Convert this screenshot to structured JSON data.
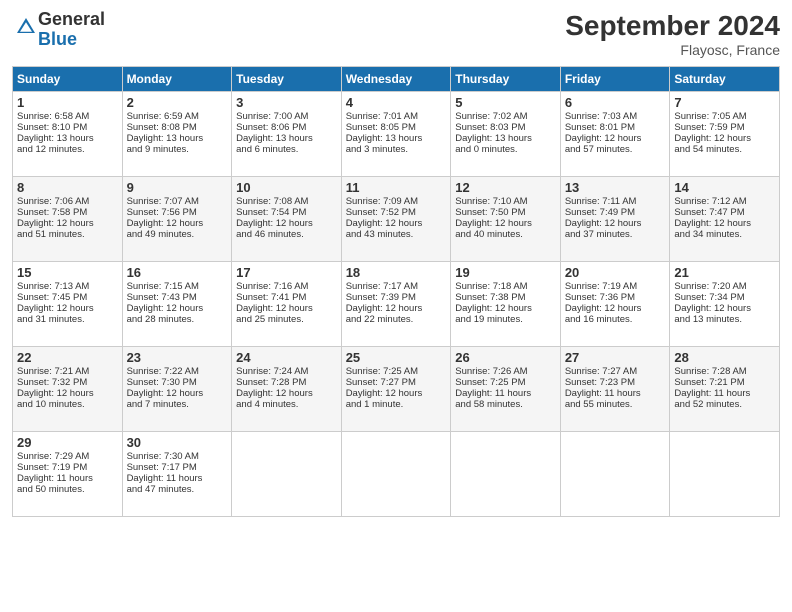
{
  "header": {
    "logo_general": "General",
    "logo_blue": "Blue",
    "month_title": "September 2024",
    "location": "Flayosc, France"
  },
  "days_of_week": [
    "Sunday",
    "Monday",
    "Tuesday",
    "Wednesday",
    "Thursday",
    "Friday",
    "Saturday"
  ],
  "weeks": [
    [
      {
        "day": "1",
        "lines": [
          "Sunrise: 6:58 AM",
          "Sunset: 8:10 PM",
          "Daylight: 13 hours",
          "and 12 minutes."
        ]
      },
      {
        "day": "2",
        "lines": [
          "Sunrise: 6:59 AM",
          "Sunset: 8:08 PM",
          "Daylight: 13 hours",
          "and 9 minutes."
        ]
      },
      {
        "day": "3",
        "lines": [
          "Sunrise: 7:00 AM",
          "Sunset: 8:06 PM",
          "Daylight: 13 hours",
          "and 6 minutes."
        ]
      },
      {
        "day": "4",
        "lines": [
          "Sunrise: 7:01 AM",
          "Sunset: 8:05 PM",
          "Daylight: 13 hours",
          "and 3 minutes."
        ]
      },
      {
        "day": "5",
        "lines": [
          "Sunrise: 7:02 AM",
          "Sunset: 8:03 PM",
          "Daylight: 13 hours",
          "and 0 minutes."
        ]
      },
      {
        "day": "6",
        "lines": [
          "Sunrise: 7:03 AM",
          "Sunset: 8:01 PM",
          "Daylight: 12 hours",
          "and 57 minutes."
        ]
      },
      {
        "day": "7",
        "lines": [
          "Sunrise: 7:05 AM",
          "Sunset: 7:59 PM",
          "Daylight: 12 hours",
          "and 54 minutes."
        ]
      }
    ],
    [
      {
        "day": "8",
        "lines": [
          "Sunrise: 7:06 AM",
          "Sunset: 7:58 PM",
          "Daylight: 12 hours",
          "and 51 minutes."
        ]
      },
      {
        "day": "9",
        "lines": [
          "Sunrise: 7:07 AM",
          "Sunset: 7:56 PM",
          "Daylight: 12 hours",
          "and 49 minutes."
        ]
      },
      {
        "day": "10",
        "lines": [
          "Sunrise: 7:08 AM",
          "Sunset: 7:54 PM",
          "Daylight: 12 hours",
          "and 46 minutes."
        ]
      },
      {
        "day": "11",
        "lines": [
          "Sunrise: 7:09 AM",
          "Sunset: 7:52 PM",
          "Daylight: 12 hours",
          "and 43 minutes."
        ]
      },
      {
        "day": "12",
        "lines": [
          "Sunrise: 7:10 AM",
          "Sunset: 7:50 PM",
          "Daylight: 12 hours",
          "and 40 minutes."
        ]
      },
      {
        "day": "13",
        "lines": [
          "Sunrise: 7:11 AM",
          "Sunset: 7:49 PM",
          "Daylight: 12 hours",
          "and 37 minutes."
        ]
      },
      {
        "day": "14",
        "lines": [
          "Sunrise: 7:12 AM",
          "Sunset: 7:47 PM",
          "Daylight: 12 hours",
          "and 34 minutes."
        ]
      }
    ],
    [
      {
        "day": "15",
        "lines": [
          "Sunrise: 7:13 AM",
          "Sunset: 7:45 PM",
          "Daylight: 12 hours",
          "and 31 minutes."
        ]
      },
      {
        "day": "16",
        "lines": [
          "Sunrise: 7:15 AM",
          "Sunset: 7:43 PM",
          "Daylight: 12 hours",
          "and 28 minutes."
        ]
      },
      {
        "day": "17",
        "lines": [
          "Sunrise: 7:16 AM",
          "Sunset: 7:41 PM",
          "Daylight: 12 hours",
          "and 25 minutes."
        ]
      },
      {
        "day": "18",
        "lines": [
          "Sunrise: 7:17 AM",
          "Sunset: 7:39 PM",
          "Daylight: 12 hours",
          "and 22 minutes."
        ]
      },
      {
        "day": "19",
        "lines": [
          "Sunrise: 7:18 AM",
          "Sunset: 7:38 PM",
          "Daylight: 12 hours",
          "and 19 minutes."
        ]
      },
      {
        "day": "20",
        "lines": [
          "Sunrise: 7:19 AM",
          "Sunset: 7:36 PM",
          "Daylight: 12 hours",
          "and 16 minutes."
        ]
      },
      {
        "day": "21",
        "lines": [
          "Sunrise: 7:20 AM",
          "Sunset: 7:34 PM",
          "Daylight: 12 hours",
          "and 13 minutes."
        ]
      }
    ],
    [
      {
        "day": "22",
        "lines": [
          "Sunrise: 7:21 AM",
          "Sunset: 7:32 PM",
          "Daylight: 12 hours",
          "and 10 minutes."
        ]
      },
      {
        "day": "23",
        "lines": [
          "Sunrise: 7:22 AM",
          "Sunset: 7:30 PM",
          "Daylight: 12 hours",
          "and 7 minutes."
        ]
      },
      {
        "day": "24",
        "lines": [
          "Sunrise: 7:24 AM",
          "Sunset: 7:28 PM",
          "Daylight: 12 hours",
          "and 4 minutes."
        ]
      },
      {
        "day": "25",
        "lines": [
          "Sunrise: 7:25 AM",
          "Sunset: 7:27 PM",
          "Daylight: 12 hours",
          "and 1 minute."
        ]
      },
      {
        "day": "26",
        "lines": [
          "Sunrise: 7:26 AM",
          "Sunset: 7:25 PM",
          "Daylight: 11 hours",
          "and 58 minutes."
        ]
      },
      {
        "day": "27",
        "lines": [
          "Sunrise: 7:27 AM",
          "Sunset: 7:23 PM",
          "Daylight: 11 hours",
          "and 55 minutes."
        ]
      },
      {
        "day": "28",
        "lines": [
          "Sunrise: 7:28 AM",
          "Sunset: 7:21 PM",
          "Daylight: 11 hours",
          "and 52 minutes."
        ]
      }
    ],
    [
      {
        "day": "29",
        "lines": [
          "Sunrise: 7:29 AM",
          "Sunset: 7:19 PM",
          "Daylight: 11 hours",
          "and 50 minutes."
        ]
      },
      {
        "day": "30",
        "lines": [
          "Sunrise: 7:30 AM",
          "Sunset: 7:17 PM",
          "Daylight: 11 hours",
          "and 47 minutes."
        ]
      },
      {
        "day": "",
        "lines": []
      },
      {
        "day": "",
        "lines": []
      },
      {
        "day": "",
        "lines": []
      },
      {
        "day": "",
        "lines": []
      },
      {
        "day": "",
        "lines": []
      }
    ]
  ]
}
